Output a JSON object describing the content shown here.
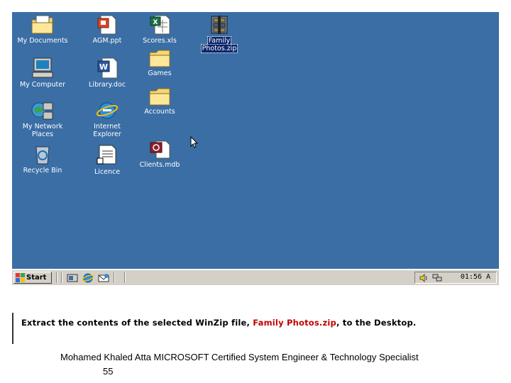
{
  "desktop": {
    "background_color": "#3a6ea5",
    "icons": [
      {
        "label": "My Documents",
        "icon": "folder-documents-icon"
      },
      {
        "label": "My Computer",
        "icon": "computer-icon"
      },
      {
        "label": "My Network",
        "label2": "Places",
        "icon": "network-places-icon"
      },
      {
        "label": "Recycle Bin",
        "icon": "recycle-bin-icon"
      },
      {
        "label": "AGM.ppt",
        "icon": "powerpoint-file-icon"
      },
      {
        "label": "Library.doc",
        "icon": "word-file-icon"
      },
      {
        "label": "Internet",
        "label2": "Explorer",
        "icon": "internet-explorer-icon"
      },
      {
        "label": "Licence",
        "icon": "text-document-icon"
      },
      {
        "label": "Scores.xls",
        "icon": "excel-file-icon"
      },
      {
        "label": "Games",
        "icon": "folder-icon"
      },
      {
        "label": "Accounts",
        "icon": "folder-icon"
      },
      {
        "label": "Clients.mdb",
        "icon": "access-file-icon"
      },
      {
        "label": "Family",
        "label2": "Photos.zip",
        "icon": "winzip-file-icon",
        "selected": true
      }
    ]
  },
  "taskbar": {
    "start_label": "Start",
    "quick_launch": [
      "show-desktop-icon",
      "internet-explorer-icon",
      "outlook-express-icon"
    ],
    "tray_icons": [
      "speaker-icon",
      "network-icon"
    ],
    "clock": "01:56 A"
  },
  "instruction": {
    "prefix": "Extract the contents of the selected WinZip file, ",
    "highlight": "Family Photos.zip",
    "suffix": ", to the Desktop.",
    "highlight_color": "#c00000"
  },
  "footer": {
    "text": "Mohamed Khaled Atta MICROSOFT Certified System Engineer & Technology Specialist",
    "page": "55"
  }
}
